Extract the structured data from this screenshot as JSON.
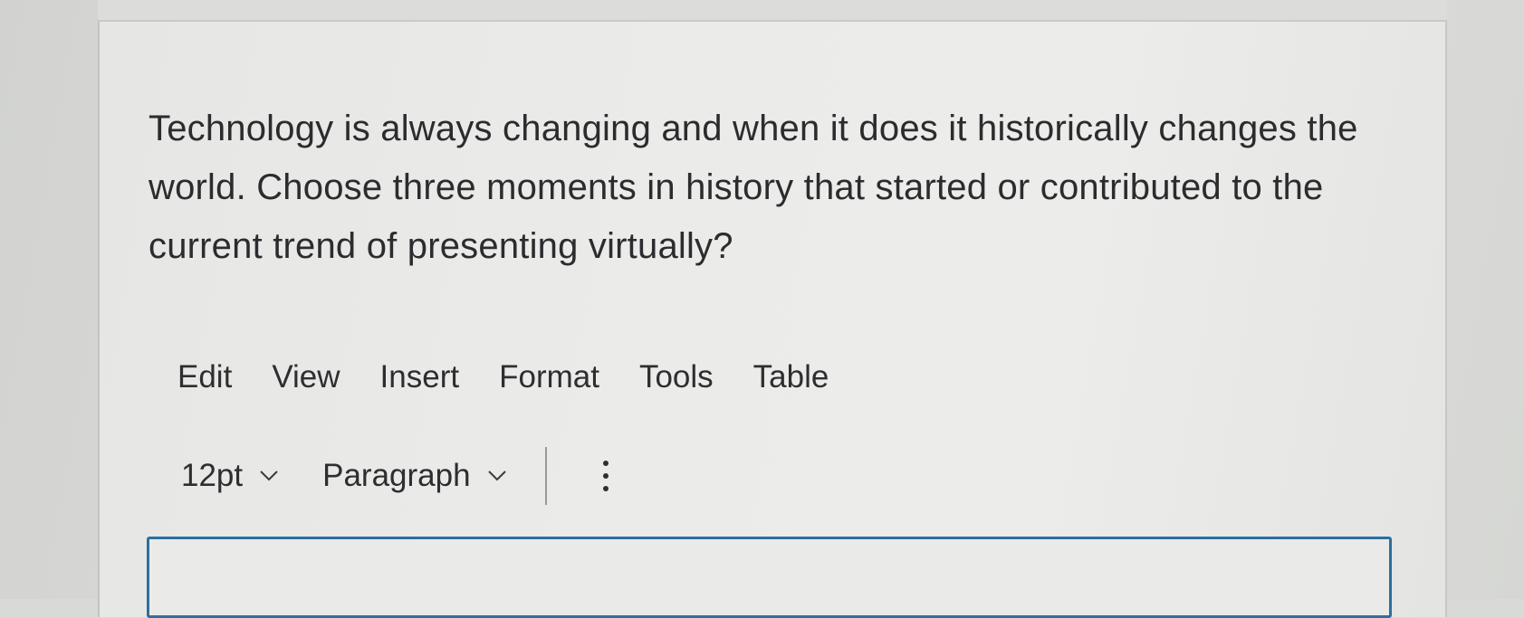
{
  "question": {
    "text": "Technology is always changing and when it does it historically changes the world. Choose three moments in history that started or contributed to the current trend of presenting virtually?"
  },
  "menubar": {
    "items": [
      "Edit",
      "View",
      "Insert",
      "Format",
      "Tools",
      "Table"
    ]
  },
  "toolbar": {
    "font_size": "12pt",
    "block_format": "Paragraph",
    "more_icon": "vertical-ellipsis-icon"
  },
  "editor": {
    "content": "",
    "focus_border_color": "#2e6f9e"
  }
}
